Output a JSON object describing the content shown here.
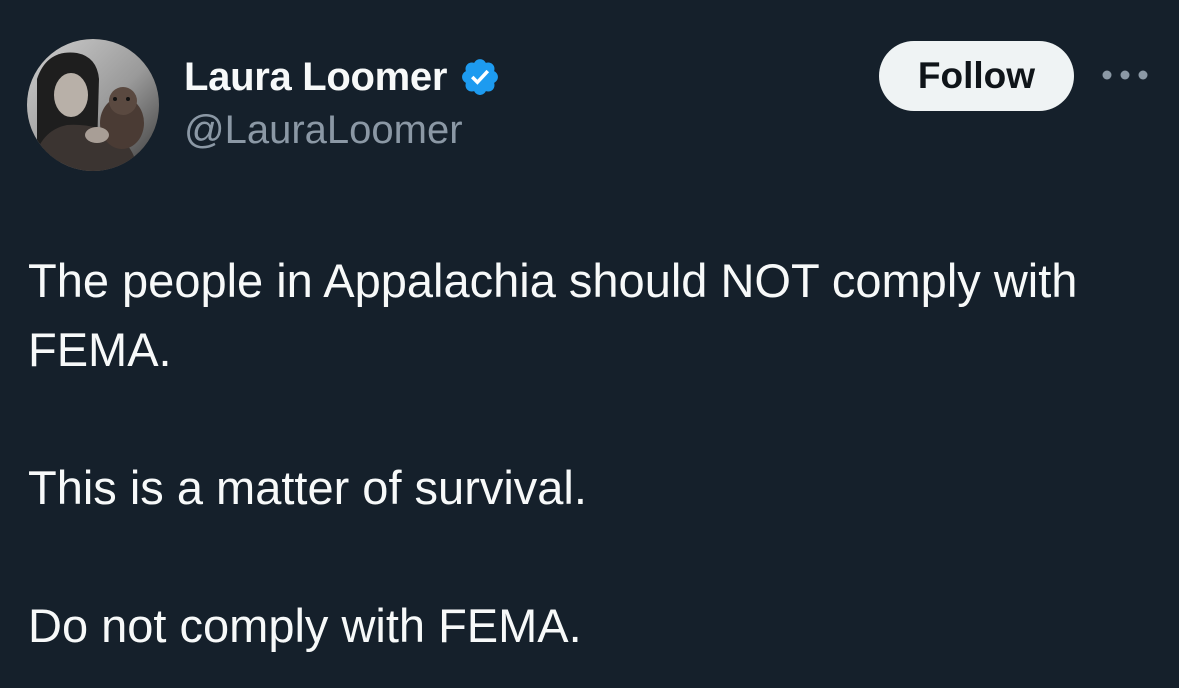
{
  "author": {
    "display_name": "Laura Loomer",
    "handle": "@LauraLoomer",
    "verified": true,
    "verified_color": "#1d9bf0"
  },
  "actions": {
    "follow_label": "Follow",
    "more_icon": "more-horizontal-icon"
  },
  "tweet": {
    "paragraphs": [
      "The people in Appalachia should NOT comply with FEMA.",
      "This is a matter of survival.",
      "Do not comply with FEMA."
    ]
  },
  "theme": {
    "background": "#15202b",
    "text": "#f7f9f9",
    "secondary_text": "#8b98a5",
    "button_bg": "#eff3f4"
  }
}
